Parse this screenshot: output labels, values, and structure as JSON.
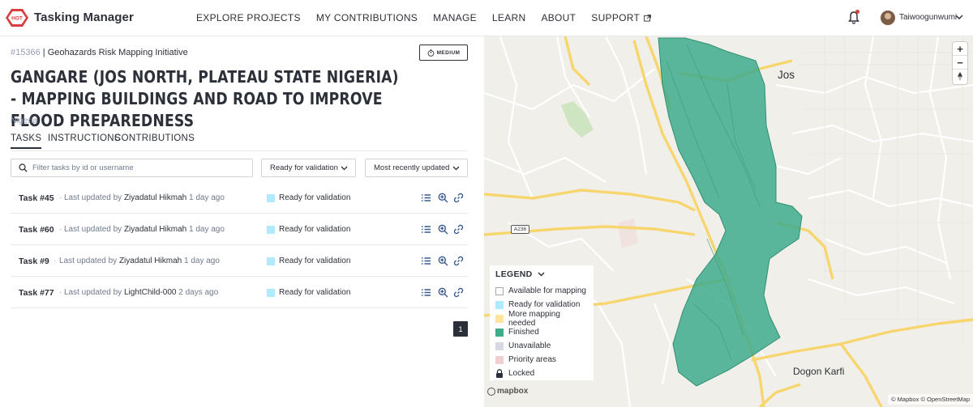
{
  "header": {
    "brand": "Tasking Manager",
    "nav": [
      "EXPLORE PROJECTS",
      "MY CONTRIBUTIONS",
      "MANAGE",
      "LEARN",
      "ABOUT",
      "SUPPORT"
    ],
    "username": "Taiwoogunwumi"
  },
  "project": {
    "id": "#15366",
    "organization": "| Geohazards Risk Mapping Initiative",
    "difficulty": "MEDIUM",
    "title": "GANGARE (JOS NORTH, PLATEAU STATE NIGERIA) - MAPPING BUILDINGS AND ROAD TO IMPROVE FLOOD PREPAREDNESS",
    "country": "Nigeria"
  },
  "tabs": [
    "TASKS",
    "INSTRUCTIONS",
    "CONTRIBUTIONS"
  ],
  "filters": {
    "search_placeholder": "Filter tasks by id or username",
    "status_filter": "Ready for validation",
    "sort": "Most recently updated"
  },
  "tasks": [
    {
      "name": "Task #45",
      "prefix": "Last updated by",
      "user": "Ziyadatul Hikmah",
      "when": "1 day ago",
      "status": "Ready for validation"
    },
    {
      "name": "Task #60",
      "prefix": "Last updated by",
      "user": "Ziyadatul Hikmah",
      "when": "1 day ago",
      "status": "Ready for validation"
    },
    {
      "name": "Task #9",
      "prefix": "Last updated by",
      "user": "Ziyadatul Hikmah",
      "when": "1 day ago",
      "status": "Ready for validation"
    },
    {
      "name": "Task #77",
      "prefix": "Last updated by",
      "user": "LightChild-000",
      "when": "2 days ago",
      "status": "Ready for validation"
    }
  ],
  "pagination": {
    "current": "1"
  },
  "map": {
    "labels": {
      "jos": "Jos",
      "dogon_karfi": "Dogon Karfi",
      "road_shield": "A236"
    },
    "zoom_in": "+",
    "zoom_out": "−",
    "mapbox": "mapbox",
    "attribution": "© Mapbox © OpenStreetMap"
  },
  "legend": {
    "title": "LEGEND",
    "items": [
      {
        "label": "Available for mapping",
        "color": "#ffffff"
      },
      {
        "label": "Ready for validation",
        "color": "#adebfd"
      },
      {
        "label": "More mapping needed",
        "color": "#ffe599"
      },
      {
        "label": "Finished",
        "color": "#40ac8c"
      },
      {
        "label": "Unavailable",
        "color": "#d6d9e3"
      },
      {
        "label": "Priority areas",
        "color": "#efcfd0"
      },
      {
        "label": "Locked",
        "color": "lock"
      }
    ]
  },
  "colors": {
    "brand_red": "#d73f3f",
    "finished_green": "#40ac8c",
    "ready_blue": "#adebfd",
    "road_yellow": "#f7d66f"
  }
}
